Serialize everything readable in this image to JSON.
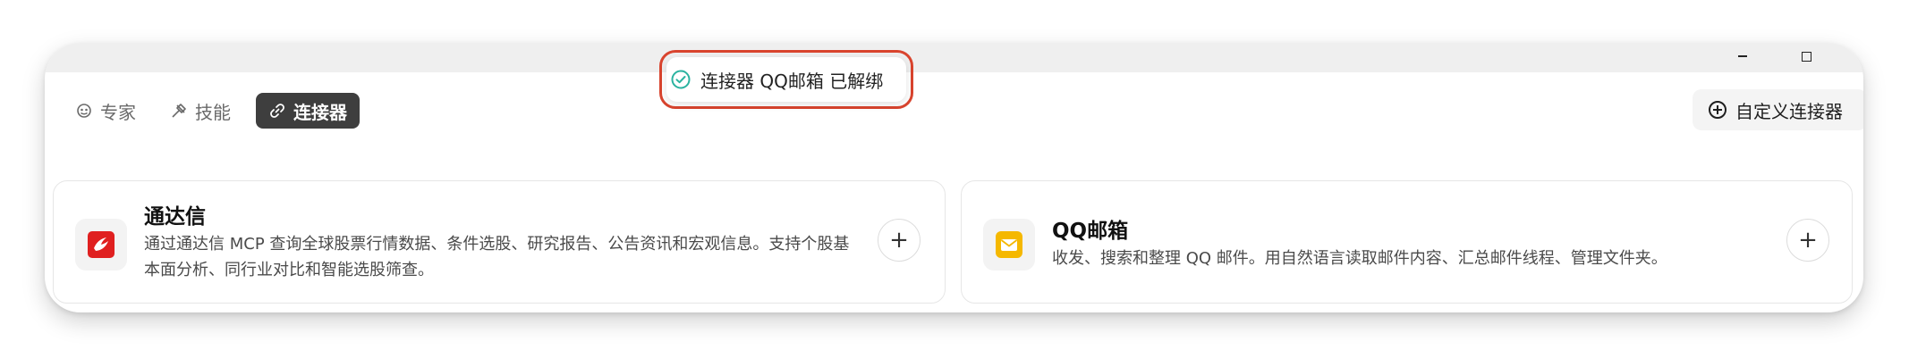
{
  "toast": {
    "message": "连接器 QQ邮箱 已解绑",
    "icon": "check-circle-icon",
    "color": "#2bb3a0"
  },
  "tabs": [
    {
      "label": "专家",
      "icon": "expert-icon",
      "active": false
    },
    {
      "label": "技能",
      "icon": "skill-icon",
      "active": false
    },
    {
      "label": "连接器",
      "icon": "link-icon",
      "active": true
    }
  ],
  "custom_button": {
    "label": "自定义连接器",
    "icon": "plus-circle-icon"
  },
  "connectors": [
    {
      "name": "通达信",
      "description": "通过通达信 MCP 查询全球股票行情数据、条件选股、研究报告、公告资讯和宏观信息。支持个股基本面分析、同行业对比和智能选股筛查。",
      "icon": "tongdaxin-logo",
      "add_label": "+"
    },
    {
      "name": "QQ邮箱",
      "description": "收发、搜索和整理 QQ 邮件。用自然语言读取邮件内容、汇总邮件线程、管理文件夹。",
      "icon": "qq-mail-logo",
      "add_label": "+"
    }
  ],
  "colors": {
    "active_tab": "#3e3e3e",
    "toast_highlight": "#d9442e",
    "tongdaxin_red": "#e02020",
    "qqmail_yellow": "#f5b800"
  }
}
